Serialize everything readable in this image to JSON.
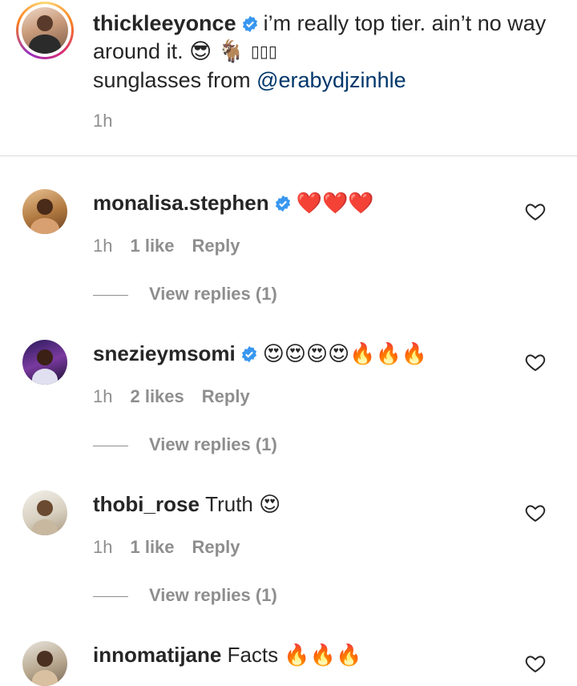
{
  "post": {
    "username": "thickleeyonce",
    "caption_line1": "i’m really top tier. ain’t no way",
    "caption_line2": "around it.",
    "caption_emojis": "😎 🐐 ",
    "caption_boxes": "▯▯▯",
    "caption_line3_prefix": "sunglasses from ",
    "caption_mention": "@erabydjzinhle",
    "time": "1h"
  },
  "comments": [
    {
      "username": "monalisa.stephen",
      "verified": true,
      "text": "❤️❤️❤️",
      "time": "1h",
      "likes": "1 like",
      "reply": "Reply",
      "view_replies": "View replies (1)"
    },
    {
      "username": "snezieymsomi",
      "verified": true,
      "text": "😍😍😍😍🔥🔥🔥",
      "time": "1h",
      "likes": "2 likes",
      "reply": "Reply",
      "view_replies": "View replies (1)"
    },
    {
      "username": "thobi_rose",
      "verified": false,
      "text": "Truth 😍",
      "time": "1h",
      "likes": "1 like",
      "reply": "Reply",
      "view_replies": "View replies (1)"
    },
    {
      "username": "innomatijane",
      "verified": false,
      "text": "Facts 🔥🔥🔥",
      "time": "",
      "likes": "",
      "reply": "",
      "view_replies": ""
    }
  ],
  "icons": {
    "verified": "verified-badge-icon",
    "like": "heart-outline-icon"
  },
  "colors": {
    "verified_blue": "#3897f0",
    "mention": "#00376b",
    "meta_gray": "#8e8e8e"
  }
}
